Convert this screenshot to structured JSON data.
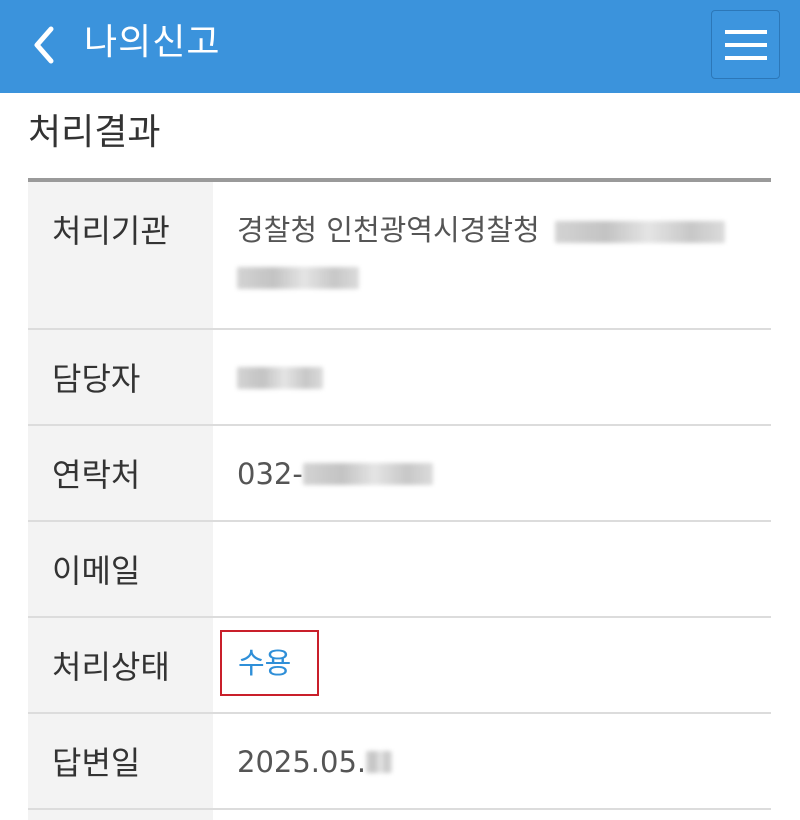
{
  "header": {
    "title": "나의신고",
    "background_color": "#3b93dc",
    "back_icon": "chevron-left-icon",
    "menu_icon": "hamburger-menu-icon"
  },
  "section": {
    "title": "처리결과"
  },
  "rows": [
    {
      "label": "처리기관",
      "value": "경찰청 인천광역시경찰청",
      "value_redacted": true
    },
    {
      "label": "담당자",
      "value": "",
      "value_redacted": true
    },
    {
      "label": "연락처",
      "value": "032-",
      "value_redacted": true
    },
    {
      "label": "이메일",
      "value": ""
    },
    {
      "label": "처리상태",
      "value": "수용",
      "status_color": "#2f8fd8",
      "highlight_color": "#c91f2a"
    },
    {
      "label": "답변일",
      "value": "2025.05.",
      "value_redacted": true
    }
  ]
}
